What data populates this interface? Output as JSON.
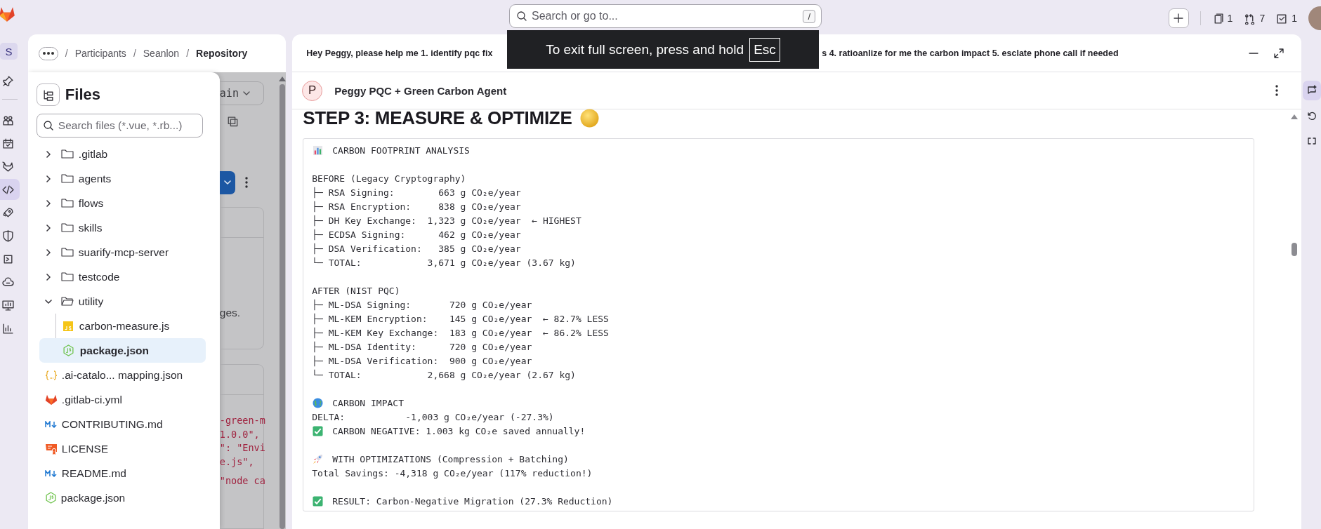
{
  "top_bar": {
    "search": {
      "placeholder": "Search or go to...",
      "shortcut": "/"
    },
    "counters": [
      {
        "kind": "issues",
        "count": "1"
      },
      {
        "kind": "merge_requests",
        "count": "7"
      },
      {
        "kind": "todos",
        "count": "1"
      }
    ]
  },
  "fullscreen_notice": {
    "text": "To exit full screen, press and hold",
    "key": "Esc"
  },
  "nav_rail": {
    "project_initial": "S",
    "items": [
      {
        "kind": "pin",
        "selected": false
      },
      {
        "kind": "people",
        "selected": false
      },
      {
        "kind": "calendar",
        "selected": false
      },
      {
        "kind": "tanuki",
        "selected": false
      },
      {
        "kind": "code",
        "selected": true
      },
      {
        "kind": "rocket",
        "selected": false
      },
      {
        "kind": "shield",
        "selected": false
      },
      {
        "kind": "deploy",
        "selected": false
      },
      {
        "kind": "cloud",
        "selected": false
      },
      {
        "kind": "monitor",
        "selected": false
      },
      {
        "kind": "chart",
        "selected": false
      }
    ]
  },
  "breadcrumb": [
    {
      "separator": "/",
      "label": "Participants",
      "current": false
    },
    {
      "separator": "/",
      "label": "Seanlon",
      "current": false
    },
    {
      "separator": "/",
      "label": "Repository",
      "current": true
    }
  ],
  "files_panel": {
    "title": "Files",
    "search_placeholder": "Search files (*.vue, *.rb...)",
    "tree": [
      {
        "kind": "folder",
        "name": ".gitlab",
        "expanded": false,
        "selected": false
      },
      {
        "kind": "folder",
        "name": "agents",
        "expanded": false,
        "selected": false
      },
      {
        "kind": "folder",
        "name": "flows",
        "expanded": false,
        "selected": false
      },
      {
        "kind": "folder",
        "name": "skills",
        "expanded": false,
        "selected": false
      },
      {
        "kind": "folder",
        "name": "suarify-mcp-server",
        "expanded": false,
        "selected": false
      },
      {
        "kind": "folder",
        "name": "testcode",
        "expanded": false,
        "selected": false
      },
      {
        "kind": "folder",
        "name": "utility",
        "expanded": true,
        "selected": false,
        "children": [
          {
            "kind": "js",
            "name": "carbon-measure.js",
            "selected": false
          },
          {
            "kind": "node",
            "name": "package.json",
            "selected": true
          }
        ]
      },
      {
        "kind": "json",
        "name": ".ai-catalo... mapping.json",
        "selected": false
      },
      {
        "kind": "gitlab",
        "name": ".gitlab-ci.yml",
        "selected": false
      },
      {
        "kind": "markdown",
        "name": "CONTRIBUTING.md",
        "selected": false
      },
      {
        "kind": "license",
        "name": "LICENSE",
        "selected": false
      },
      {
        "kind": "markdown",
        "name": "README.md",
        "selected": false
      },
      {
        "kind": "node",
        "name": "package.json",
        "selected": false
      }
    ]
  },
  "background_view": {
    "branch": "ain",
    "fragment": "ges.",
    "code_groups": [
      [
        "-green-m",
        "1.0.0\",",
        "\": \"Envi",
        "e.js\","
      ],
      [
        "\"node ca"
      ]
    ]
  },
  "chat": {
    "prompt_start": "Hey Peggy, please help me 1. identify pqc fix",
    "prompt_end": "s 4. ratioanlize for me the carbon impact 5. esclate phone call if needed",
    "agent": {
      "initial": "P",
      "name": "Peggy PQC + Green Carbon Agent"
    },
    "heading": "STEP 3: MEASURE & OPTIMIZE",
    "sections": [
      {
        "lines": [
          {
            "kind": "chart",
            "text": "CARBON FOOTPRINT ANALYSIS"
          }
        ]
      },
      {
        "lines": [
          {
            "text": "BEFORE (Legacy Cryptography)"
          },
          {
            "text": "├─ RSA Signing:        663 g CO₂e/year"
          },
          {
            "text": "├─ RSA Encryption:     838 g CO₂e/year"
          },
          {
            "text": "├─ DH Key Exchange:  1,323 g CO₂e/year  ← HIGHEST"
          },
          {
            "text": "├─ ECDSA Signing:      462 g CO₂e/year"
          },
          {
            "text": "├─ DSA Verification:   385 g CO₂e/year"
          },
          {
            "text": "└─ TOTAL:            3,671 g CO₂e/year (3.67 kg)"
          }
        ]
      },
      {
        "lines": [
          {
            "text": "AFTER (NIST PQC)"
          },
          {
            "text": "├─ ML-DSA Signing:       720 g CO₂e/year"
          },
          {
            "text": "├─ ML-KEM Encryption:    145 g CO₂e/year  ← 82.7% LESS"
          },
          {
            "text": "├─ ML-KEM Key Exchange:  183 g CO₂e/year  ← 86.2% LESS"
          },
          {
            "text": "├─ ML-DSA Identity:      720 g CO₂e/year"
          },
          {
            "text": "├─ ML-DSA Verification:  900 g CO₂e/year"
          },
          {
            "text": "└─ TOTAL:            2,668 g CO₂e/year (2.67 kg)"
          }
        ]
      },
      {
        "lines": [
          {
            "kind": "globe",
            "text": "CARBON IMPACT"
          },
          {
            "text": "DELTA:           -1,003 g CO₂e/year (-27.3%)"
          },
          {
            "kind": "check",
            "text": "CARBON NEGATIVE: 1.003 kg CO₂e saved annually!"
          }
        ]
      },
      {
        "lines": [
          {
            "kind": "rocket",
            "text": "WITH OPTIMIZATIONS (Compression + Batching)"
          },
          {
            "text": "Total Savings: -4,318 g CO₂e/year (117% reduction!)"
          }
        ]
      },
      {
        "lines": [
          {
            "kind": "check",
            "text": "RESULT: Carbon-Negative Migration (27.3% Reduction)"
          }
        ]
      }
    ]
  },
  "right_rail": [
    {
      "kind": "sparkle-chat",
      "selected": true
    },
    {
      "kind": "history",
      "selected": false
    },
    {
      "kind": "snippet",
      "selected": false
    }
  ]
}
